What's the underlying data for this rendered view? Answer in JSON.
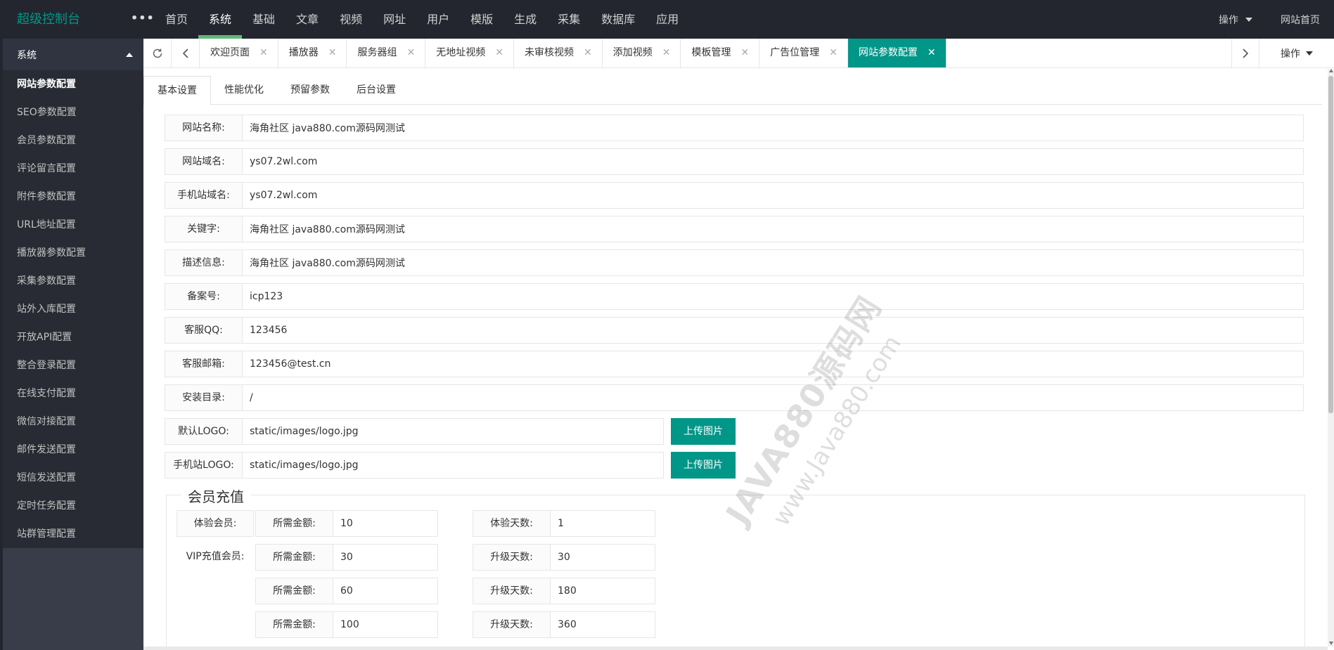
{
  "header": {
    "brand": "超级控制台",
    "more": "•••",
    "nav": [
      "首页",
      "系统",
      "基础",
      "文章",
      "视频",
      "网址",
      "用户",
      "模版",
      "生成",
      "采集",
      "数据库",
      "应用"
    ],
    "active_nav": "系统",
    "ops": "操作",
    "site_home": "网站首页",
    "accent_color": "#5fb878"
  },
  "sidebar": {
    "title": "系统",
    "items": [
      "网站参数配置",
      "SEO参数配置",
      "会员参数配置",
      "评论留言配置",
      "附件参数配置",
      "URL地址配置",
      "播放器参数配置",
      "采集参数配置",
      "站外入库配置",
      "开放API配置",
      "整合登录配置",
      "在线支付配置",
      "微信对接配置",
      "邮件发送配置",
      "短信发送配置",
      "定时任务配置",
      "站群管理配置"
    ],
    "active_item": "网站参数配置"
  },
  "tabstrip": {
    "refresh_icon": "refresh-icon",
    "tabs": [
      "欢迎页面",
      "播放器",
      "服务器组",
      "无地址视频",
      "未审核视频",
      "添加视频",
      "模板管理",
      "广告位管理",
      "网站参数配置"
    ],
    "active_tab": "网站参数配置",
    "close_glyph": "✕",
    "ops": "操作",
    "active_color": "#009688"
  },
  "subtabs": [
    "基本设置",
    "性能优化",
    "预留参数",
    "后台设置"
  ],
  "form": {
    "fields": [
      {
        "label": "网站名称:",
        "value": "海角社区 java880.com源码网测试"
      },
      {
        "label": "网站域名:",
        "value": "ys07.2wl.com"
      },
      {
        "label": "手机站域名:",
        "value": "ys07.2wl.com"
      },
      {
        "label": "关键字:",
        "value": "海角社区 java880.com源码网测试"
      },
      {
        "label": "描述信息:",
        "value": "海角社区 java880.com源码网测试"
      },
      {
        "label": "备案号:",
        "value": "icp123"
      },
      {
        "label": "客服QQ:",
        "value": "123456"
      },
      {
        "label": "客服邮箱:",
        "value": "123456@test.cn"
      },
      {
        "label": "安装目录:",
        "value": "/"
      }
    ],
    "logo_fields": [
      {
        "label": "默认LOGO:",
        "value": "static/images/logo.jpg",
        "button": "上传图片"
      },
      {
        "label": "手机站LOGO:",
        "value": "static/images/logo.jpg",
        "button": "上传图片"
      }
    ]
  },
  "recharge": {
    "legend": "会员充值",
    "trial_label": "体验会员:",
    "vip_label": "VIP充值会员:",
    "amount_label": "所需金额:",
    "trial_days_label": "体验天数:",
    "upgrade_days_label": "升级天数:",
    "trial": {
      "amount": "10",
      "days": "1"
    },
    "vip": [
      {
        "amount": "30",
        "days": "30"
      },
      {
        "amount": "60",
        "days": "180"
      },
      {
        "amount": "100",
        "days": "360"
      }
    ]
  },
  "watermark": {
    "line1": "JAVA880源码网",
    "line2": "www.Java880.com"
  }
}
